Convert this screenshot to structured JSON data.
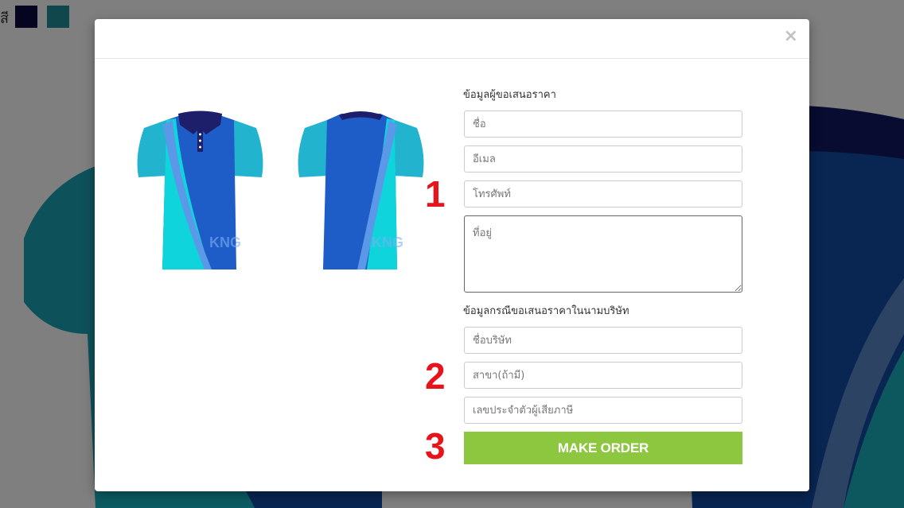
{
  "background": {
    "color_label": "สี",
    "swatches": [
      "#0c0a3e",
      "#1f8f9b"
    ]
  },
  "modal": {
    "close_glyph": "×",
    "requester_section_label": "ข้อมูลผู้ขอเสนอราคา",
    "name_placeholder": "ชื่อ",
    "email_placeholder": "อีเมล",
    "phone_placeholder": "โทรศัพท์",
    "address_placeholder": "ที่อยู่",
    "company_section_label": "ข้อมูลกรณีขอเสนอราคาในนามบริษัท",
    "company_name_placeholder": "ชื่อบริษัท",
    "branch_placeholder": "สาขา(ถ้ามี)",
    "tax_id_placeholder": "เลขประจำตัวผู้เสียภาษี",
    "order_button_label": "MAKE  ORDER",
    "step_numbers": [
      "1",
      "2",
      "3"
    ]
  },
  "shirt": {
    "watermark": "KNG",
    "colors": {
      "navy": "#1d1f6b",
      "royal_blue": "#1e5cc8",
      "cyan": "#0fd4dc",
      "sky": "#5b98e8",
      "sleeve": "#22b4cf"
    }
  }
}
